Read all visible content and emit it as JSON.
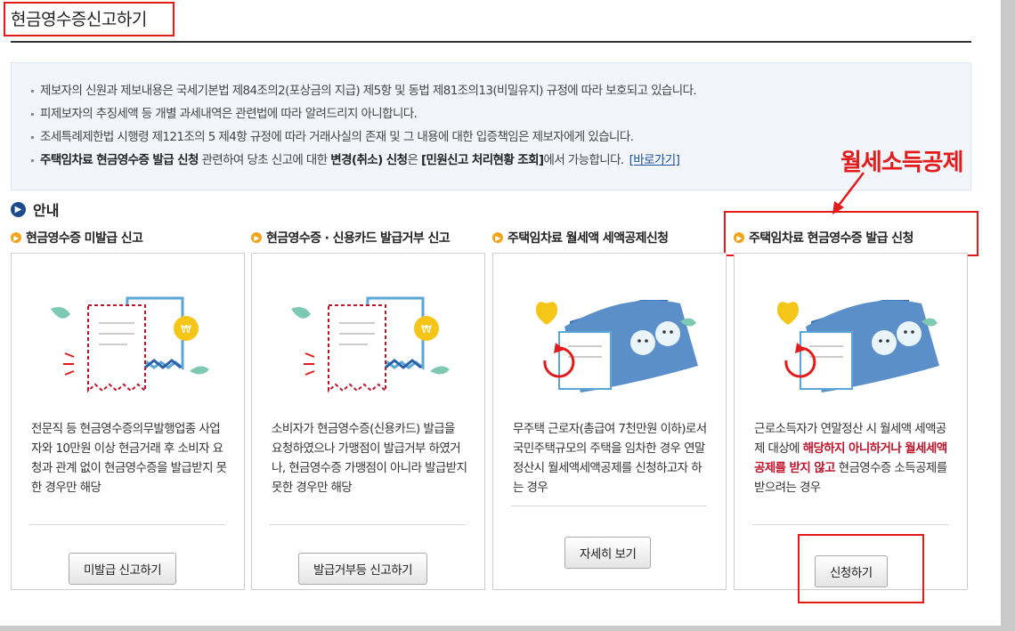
{
  "header": {
    "title": "현금영수증신고하기"
  },
  "notice": {
    "line1": "제보자의 신원과 제보내용은 국세기본법 제84조의2(포상금의 지급) 제5항 및 동법 제81조의13(비밀유지) 규정에 따라 보호되고 있습니다.",
    "line2": "피제보자의 추징세액 등 개별 과세내역은 관련법에 따라 알려드리지 아니합니다.",
    "line3": "조세특례제한법 시행령 제121조의 5 제4항 규정에 따라 거래사실의 존재 및 그 내용에 대한 입증책임은 제보자에게 있습니다.",
    "line4_bold1": "주택임차료 현금영수증 발급 신청",
    "line4_text1": " 관련하여 당초 신고에 대한 ",
    "line4_bold2": "변경(취소) 신청",
    "line4_text2": "은 ",
    "line4_bold3": "[민원신고 처리현황 조회]",
    "line4_text3": "에서 가능합니다.",
    "line4_link": "[바로가기]"
  },
  "annotation": {
    "label": "월세소득공제"
  },
  "guide": {
    "label": "안내"
  },
  "cards": [
    {
      "title": "현금영수증 미발급 신고",
      "desc": "전문직 등 현금영수증의무발행업종 사업자와 10만원 이상 현금거래 후 소비자 요청과 관계 없이 현금영수증을 발급받지 못한 경우만 해당",
      "button": "미발급 신고하기"
    },
    {
      "title": "현금영수증 · 신용카드 발급거부 신고",
      "desc": "소비자가 현금영수증(신용카드) 발급을 요청하였으나 가맹점이 발급거부 하였거나, 현금영수증 가맹점이 아니라 발급받지 못한 경우만 해당",
      "button": "발급거부등 신고하기"
    },
    {
      "title": "주택임차료 월세액 세액공제신청",
      "desc": "무주택 근로자(총급여 7천만원 이하)로서 국민주택규모의 주택을 임차한 경우 연말정산시 월세액세액공제를 신청하고자 하는 경우",
      "button": "자세히 보기"
    },
    {
      "title": "주택임차료 현금영수증 발급 신청",
      "desc_pre": "근로소득자가 연말정산 시 월세액 세액공제 대상에 ",
      "desc_red": "해당하지 아니하거나 월세세액공제를 받지 않고",
      "desc_post": " 현금영수증 소득공제를 받으려는 경우",
      "button": "신청하기"
    }
  ],
  "colors": {
    "annotation_red": "#e31b1b",
    "accent_blue": "#1c4c8c",
    "bullet_orange": "#f2a318"
  }
}
